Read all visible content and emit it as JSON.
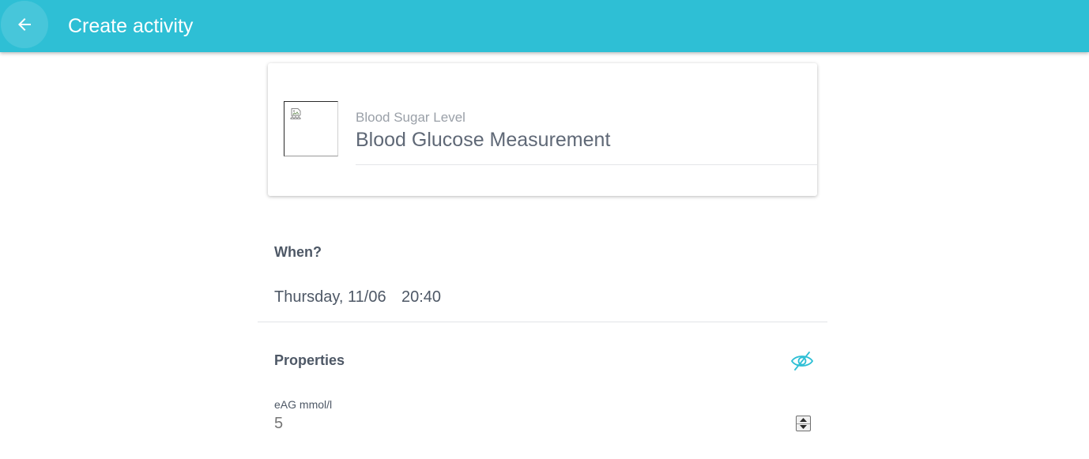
{
  "appbar": {
    "title": "Create activity",
    "back_icon": "arrow-left-icon",
    "background": "#2ebfd5"
  },
  "activity": {
    "category": "Blood Sugar Level",
    "name": "Blood Glucose Measurement",
    "image_icon": "broken-image-icon"
  },
  "when": {
    "heading": "When?",
    "date": "Thursday, 11/06",
    "time": "20:40"
  },
  "properties": {
    "heading": "Properties",
    "visibility_icon": "eye-off-icon",
    "accent": "#2ebfd5",
    "fields": [
      {
        "label": "eAG mmol/l",
        "placeholder": "5",
        "value": ""
      }
    ]
  }
}
